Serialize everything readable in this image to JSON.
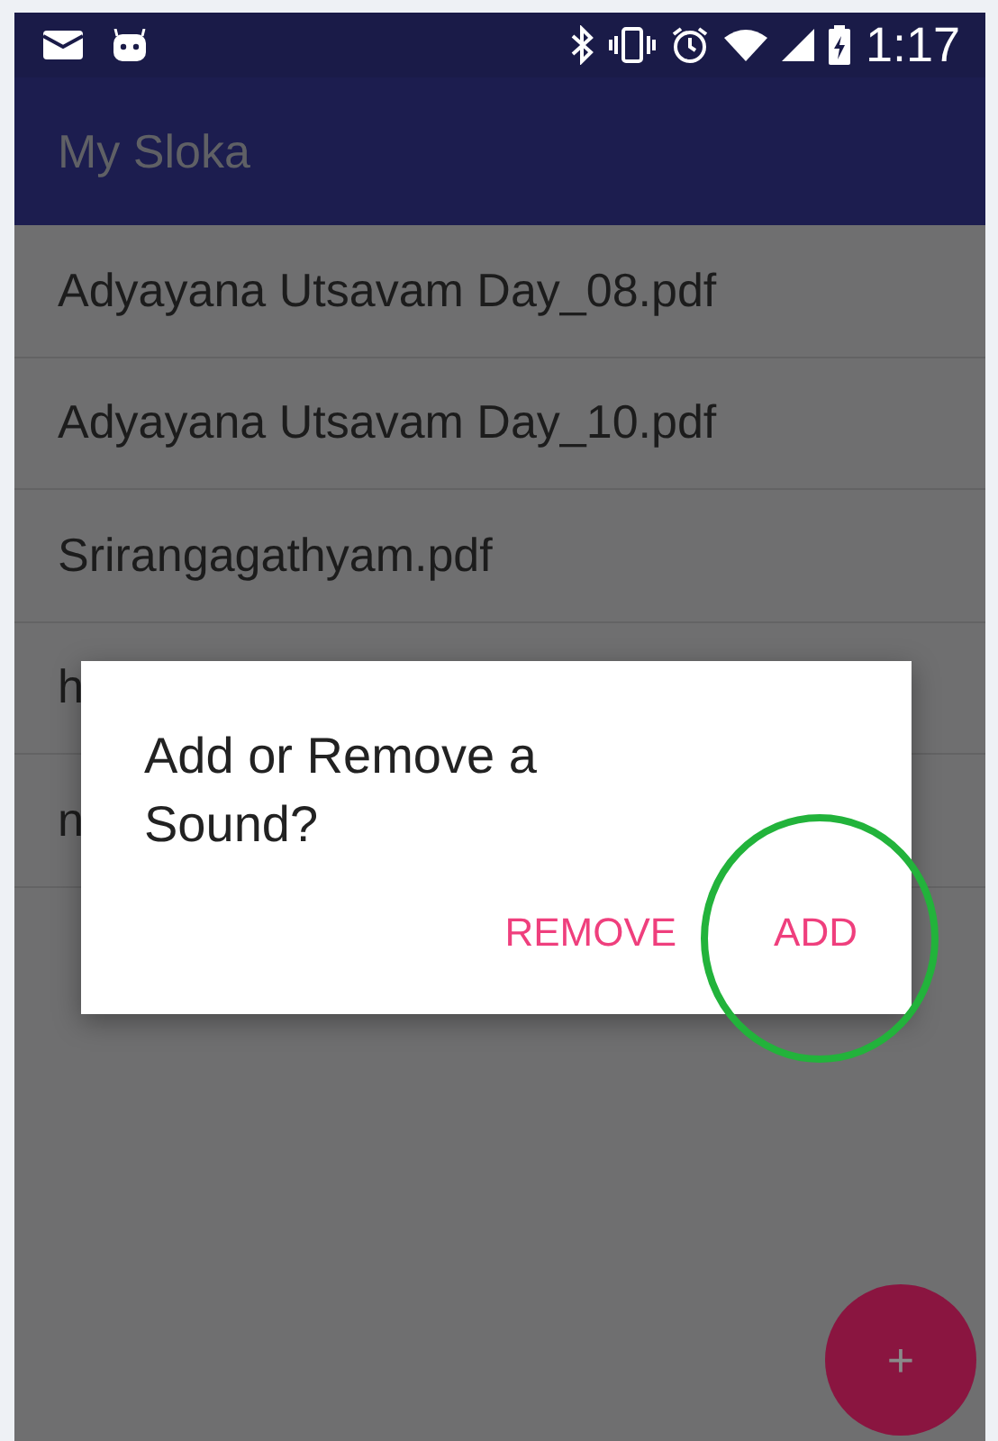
{
  "status_bar": {
    "time": "1:17"
  },
  "app_bar": {
    "title": "My Sloka"
  },
  "files": [
    {
      "name": "Adyayana Utsavam Day_08.pdf"
    },
    {
      "name": "Adyayana Utsavam Day_10.pdf"
    },
    {
      "name": "Srirangagathyam.pdf"
    },
    {
      "name": "h"
    },
    {
      "name": "n"
    }
  ],
  "dialog": {
    "title": "Add or Remove a Sound?",
    "buttons": [
      {
        "label": "REMOVE",
        "circled": false
      },
      {
        "label": "ADD",
        "circled": true
      }
    ]
  },
  "fab": {
    "label": "+"
  }
}
